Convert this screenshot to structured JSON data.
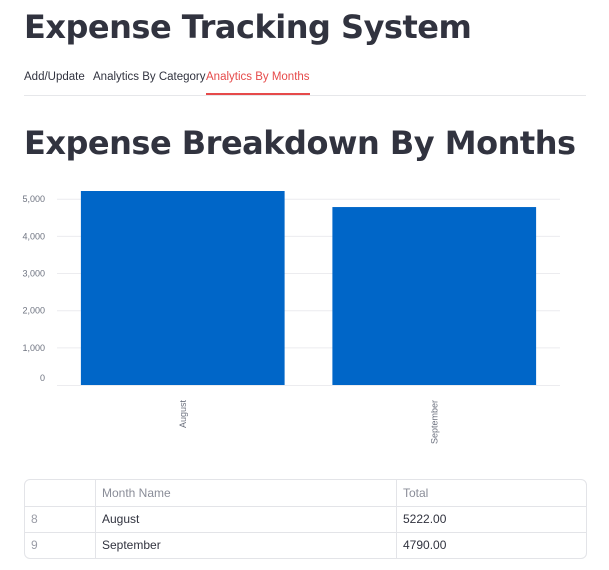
{
  "app": {
    "title": "Expense Tracking System"
  },
  "tabs": [
    {
      "label": "Add/Update",
      "active": false
    },
    {
      "label": "Analytics By Category",
      "active": false
    },
    {
      "label": "Analytics By Months",
      "active": true
    }
  ],
  "section": {
    "title": "Expense Breakdown By Months"
  },
  "chart_data": {
    "type": "bar",
    "categories": [
      "August",
      "September"
    ],
    "values": [
      5222.0,
      4790.0
    ],
    "ylim": [
      0,
      5222
    ],
    "yticks": [
      "0",
      "1,000",
      "2,000",
      "3,000",
      "4,000",
      "5,000"
    ],
    "bar_color": "#0066c8",
    "grid": true
  },
  "table": {
    "columns": [
      "",
      "Month Name",
      "Total"
    ],
    "rows": [
      {
        "index": "8",
        "month": "August",
        "total": "5222.00"
      },
      {
        "index": "9",
        "month": "September",
        "total": "4790.00"
      }
    ]
  },
  "colors": {
    "accent": "#e64a4a",
    "text": "#31333f",
    "bar": "#0066c8"
  }
}
